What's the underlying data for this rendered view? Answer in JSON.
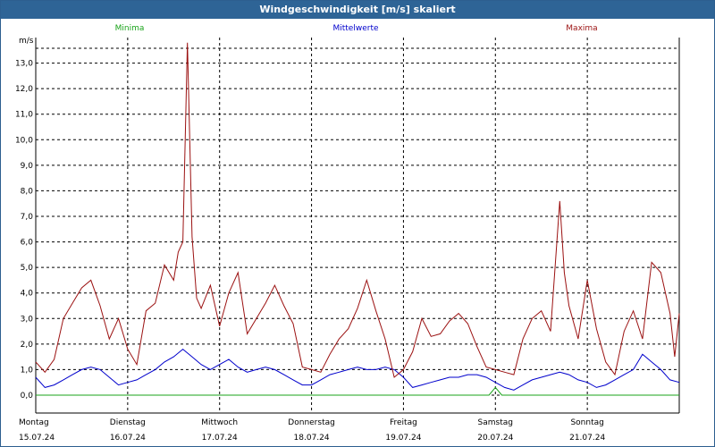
{
  "title": "Windgeschwindigkeit [m/s] skaliert",
  "colors": {
    "minima": "#1aa31a",
    "mittel": "#0000cc",
    "maxima": "#9b1111",
    "grid": "#000000",
    "titlebar": "#2e6496"
  },
  "chart_data": {
    "type": "line",
    "title": "Windgeschwindigkeit [m/s] skaliert",
    "ylabel": "m/s",
    "xlabel": "",
    "ylim": [
      -0.7,
      14.0
    ],
    "yticks": [
      0.0,
      1.0,
      2.0,
      3.0,
      4.0,
      5.0,
      6.0,
      7.0,
      8.0,
      9.0,
      10.0,
      11.0,
      12.0,
      13.0
    ],
    "ytick_labels": [
      "0,0",
      "1,0",
      "2,0",
      "3,0",
      "4,0",
      "5,0",
      "6,0",
      "7,0",
      "8,0",
      "9,0",
      "10,0",
      "11,0",
      "12,0",
      "13,0"
    ],
    "x_range_days": [
      0,
      7
    ],
    "x_unit": "days",
    "days": [
      {
        "name": "Montag",
        "date": "15.07.24"
      },
      {
        "name": "Dienstag",
        "date": "16.07.24"
      },
      {
        "name": "Mittwoch",
        "date": "17.07.24"
      },
      {
        "name": "Donnerstag",
        "date": "18.07.24"
      },
      {
        "name": "Freitag",
        "date": "19.07.24"
      },
      {
        "name": "Samstag",
        "date": "20.07.24"
      },
      {
        "name": "Sonntag",
        "date": "21.07.24"
      }
    ],
    "grid": true,
    "legend_position": "top",
    "series": [
      {
        "name": "Minima",
        "x": [
          0,
          4.93,
          5.0,
          5.07,
          7.0
        ],
        "y": [
          0.0,
          0.0,
          0.3,
          0.0,
          0.0
        ]
      },
      {
        "name": "Mittelwerte",
        "x": [
          0,
          0.1,
          0.2,
          0.3,
          0.4,
          0.5,
          0.6,
          0.7,
          0.8,
          0.9,
          1.0,
          1.1,
          1.2,
          1.3,
          1.4,
          1.5,
          1.6,
          1.7,
          1.8,
          1.9,
          2.0,
          2.1,
          2.2,
          2.3,
          2.4,
          2.5,
          2.6,
          2.7,
          2.8,
          2.9,
          3.0,
          3.1,
          3.2,
          3.3,
          3.4,
          3.5,
          3.6,
          3.7,
          3.8,
          3.9,
          4.0,
          4.1,
          4.2,
          4.3,
          4.4,
          4.5,
          4.6,
          4.7,
          4.8,
          4.9,
          5.0,
          5.1,
          5.2,
          5.3,
          5.4,
          5.5,
          5.6,
          5.7,
          5.8,
          5.9,
          6.0,
          6.1,
          6.2,
          6.3,
          6.4,
          6.5,
          6.6,
          6.7,
          6.8,
          6.9,
          7.0
        ],
        "y": [
          0.7,
          0.3,
          0.4,
          0.6,
          0.8,
          1.0,
          1.1,
          1.0,
          0.7,
          0.4,
          0.5,
          0.6,
          0.8,
          1.0,
          1.3,
          1.5,
          1.8,
          1.5,
          1.2,
          1.0,
          1.2,
          1.4,
          1.1,
          0.9,
          1.0,
          1.1,
          1.0,
          0.8,
          0.6,
          0.4,
          0.4,
          0.6,
          0.8,
          0.9,
          1.0,
          1.1,
          1.0,
          1.0,
          1.1,
          1.0,
          0.7,
          0.3,
          0.4,
          0.5,
          0.6,
          0.7,
          0.7,
          0.8,
          0.8,
          0.7,
          0.5,
          0.3,
          0.2,
          0.4,
          0.6,
          0.7,
          0.8,
          0.9,
          0.8,
          0.6,
          0.5,
          0.3,
          0.4,
          0.6,
          0.8,
          1.0,
          1.6,
          1.3,
          1.0,
          0.6,
          0.5
        ]
      },
      {
        "name": "Maxima",
        "x": [
          0,
          0.1,
          0.2,
          0.3,
          0.4,
          0.5,
          0.6,
          0.7,
          0.8,
          0.9,
          1.0,
          1.1,
          1.2,
          1.3,
          1.4,
          1.5,
          1.55,
          1.6,
          1.65,
          1.7,
          1.75,
          1.8,
          1.9,
          2.0,
          2.1,
          2.2,
          2.3,
          2.4,
          2.5,
          2.6,
          2.7,
          2.8,
          2.9,
          3.0,
          3.1,
          3.2,
          3.3,
          3.4,
          3.5,
          3.6,
          3.7,
          3.8,
          3.9,
          4.0,
          4.1,
          4.2,
          4.3,
          4.4,
          4.5,
          4.6,
          4.7,
          4.8,
          4.9,
          5.0,
          5.1,
          5.2,
          5.3,
          5.4,
          5.5,
          5.6,
          5.7,
          5.75,
          5.8,
          5.9,
          6.0,
          6.1,
          6.2,
          6.3,
          6.4,
          6.5,
          6.6,
          6.7,
          6.8,
          6.9,
          6.95,
          7.0
        ],
        "y": [
          1.3,
          0.9,
          1.4,
          3.0,
          3.6,
          4.2,
          4.5,
          3.5,
          2.2,
          3.0,
          1.8,
          1.2,
          3.3,
          3.6,
          5.1,
          4.5,
          5.6,
          6.0,
          13.8,
          6.2,
          3.8,
          3.4,
          4.3,
          2.7,
          4.0,
          4.8,
          2.4,
          3.0,
          3.6,
          4.3,
          3.5,
          2.8,
          1.1,
          1.0,
          0.9,
          1.6,
          2.2,
          2.6,
          3.4,
          4.5,
          3.3,
          2.2,
          0.7,
          1.0,
          1.7,
          3.0,
          2.3,
          2.4,
          2.9,
          3.2,
          2.8,
          1.9,
          1.1,
          1.0,
          0.9,
          0.8,
          2.2,
          3.0,
          3.3,
          2.5,
          7.6,
          4.8,
          3.5,
          2.2,
          4.5,
          2.6,
          1.3,
          0.8,
          2.5,
          3.3,
          2.2,
          5.2,
          4.8,
          3.2,
          1.5,
          3.2
        ]
      }
    ]
  }
}
